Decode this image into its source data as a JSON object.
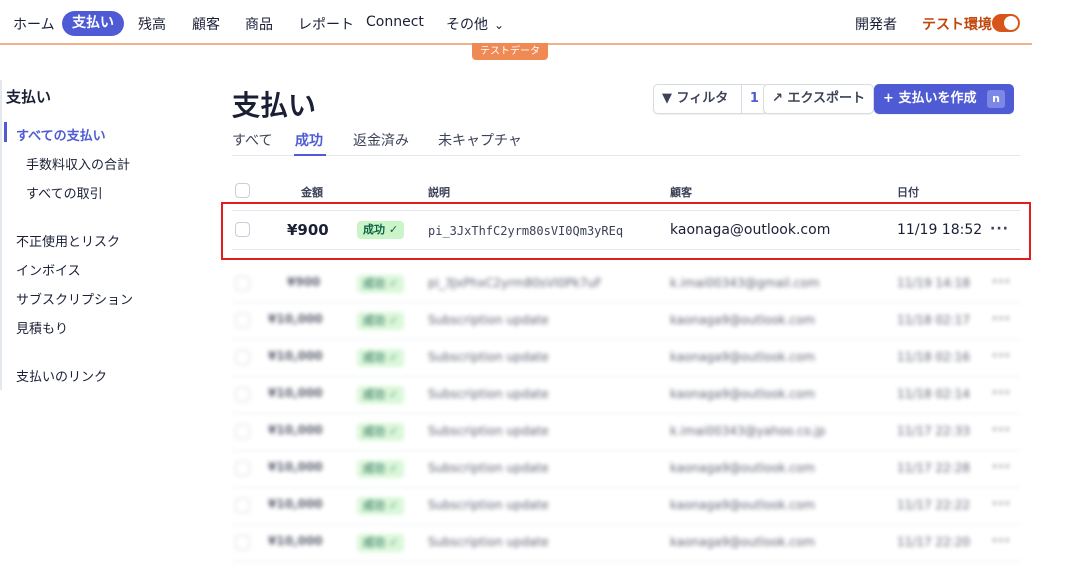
{
  "nav": {
    "items": [
      "ホーム",
      "支払い",
      "残高",
      "顧客",
      "商品",
      "レポート",
      "Connect",
      "その他"
    ],
    "developer": "開発者",
    "test_mode": "テスト環境",
    "testdata_badge": "テストデータ",
    "accent_color": "#4f5bd5",
    "test_color": "#c0450b"
  },
  "sidebar": {
    "title": "支払い",
    "items": [
      "すべての支払い",
      "手数料収入の合計",
      "すべての取引",
      "不正使用とリスク",
      "インボイス",
      "サブスクリプション",
      "見積もり",
      "支払いのリンク"
    ]
  },
  "page": {
    "title": "支払い",
    "filter_label": "フィルタ",
    "filter_count": "1",
    "export_label": "エクスポート",
    "create_label": "支払いを作成",
    "create_shortcut": "n"
  },
  "tabs": [
    "すべて",
    "成功",
    "返金済み",
    "未キャプチャ"
  ],
  "table": {
    "headers": {
      "amount": "金額",
      "description": "説明",
      "customer": "顧客",
      "date": "日付"
    },
    "rows": [
      {
        "amount": "¥900",
        "status": "成功",
        "description": "pi_3JxThfC2yrm80sVI0Qm3yREq",
        "customer": "kaonaga@outlook.com",
        "date": "11/19 18:52"
      }
    ],
    "blurred_rows": [
      {
        "amount": "¥900",
        "status": "成功",
        "description": "pi_3JxPhxC2yrm80sVI0Pk7uF",
        "customer": "k.imai00343@gmail.com",
        "date": "11/19 14:18"
      },
      {
        "amount": "¥10,000",
        "status": "成功",
        "description": "Subscription update",
        "customer": "kaonaga9@outlook.com",
        "date": "11/18 02:17"
      },
      {
        "amount": "¥10,000",
        "status": "成功",
        "description": "Subscription update",
        "customer": "kaonaga9@outlook.com",
        "date": "11/18 02:16"
      },
      {
        "amount": "¥10,000",
        "status": "成功",
        "description": "Subscription update",
        "customer": "kaonaga9@outlook.com",
        "date": "11/18 02:14"
      },
      {
        "amount": "¥10,000",
        "status": "成功",
        "description": "Subscription update",
        "customer": "k.imai00343@yahoo.co.jp",
        "date": "11/17 22:33"
      },
      {
        "amount": "¥10,000",
        "status": "成功",
        "description": "Subscription update",
        "customer": "kaonaga9@outlook.com",
        "date": "11/17 22:28"
      },
      {
        "amount": "¥10,000",
        "status": "成功",
        "description": "Subscription update",
        "customer": "kaonaga9@outlook.com",
        "date": "11/17 22:22"
      },
      {
        "amount": "¥10,000",
        "status": "成功",
        "description": "Subscription update",
        "customer": "kaonaga9@outlook.com",
        "date": "11/17 22:20"
      }
    ]
  }
}
